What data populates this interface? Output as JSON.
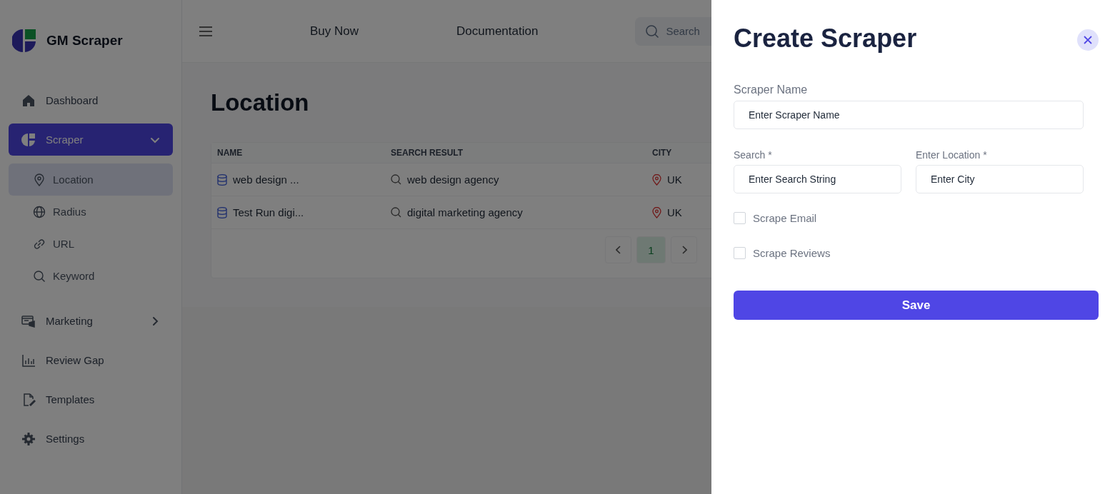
{
  "sidebar": {
    "brand": "GM Scraper",
    "items": [
      {
        "label": "Dashboard",
        "selected": false
      },
      {
        "label": "Scraper",
        "selected": true,
        "expanded": true,
        "children": [
          {
            "label": "Location",
            "selected": true
          },
          {
            "label": "Radius",
            "selected": false
          },
          {
            "label": "URL",
            "selected": false
          },
          {
            "label": "Keyword",
            "selected": false
          }
        ]
      },
      {
        "label": "Marketing",
        "selected": false,
        "expanded": false
      },
      {
        "label": "Review Gap",
        "selected": false
      },
      {
        "label": "Templates",
        "selected": false
      },
      {
        "label": "Settings",
        "selected": false
      }
    ]
  },
  "header": {
    "links": [
      "Buy Now",
      "Documentation"
    ],
    "search": {
      "placeholder": "Search"
    }
  },
  "page": {
    "title": "Location"
  },
  "table": {
    "columns": [
      "NAME",
      "SEARCH RESULT",
      "CITY"
    ],
    "rows": [
      {
        "name": "web design ...",
        "search": "web design agency",
        "city": "UK"
      },
      {
        "name": "Test Run digi...",
        "search": "digital marketing agency",
        "city": "UK"
      }
    ]
  },
  "pagination": {
    "pages": [
      {
        "label": "1",
        "selected": true
      }
    ]
  },
  "drawer": {
    "title": "Create Scraper",
    "fields": [
      {
        "label": "Scraper Name",
        "placeholder": "Enter Scraper Name"
      },
      {
        "label": "Search *",
        "placeholder": "Enter Search String"
      },
      {
        "label": "Enter Location *",
        "placeholder": "Enter City"
      }
    ],
    "checkboxes": [
      {
        "label": "Scrape Email",
        "checked": false
      },
      {
        "label": "Scrape Reviews",
        "checked": false
      }
    ],
    "save_button": "Save"
  }
}
